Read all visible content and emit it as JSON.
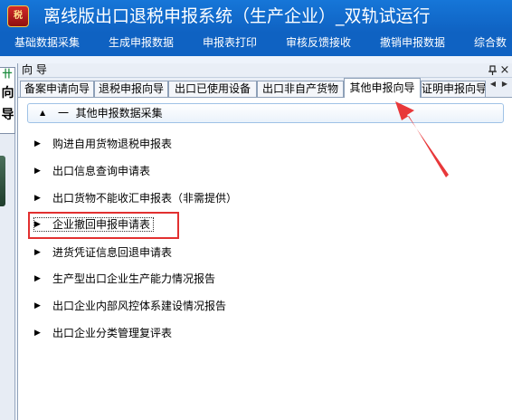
{
  "app": {
    "title": "离线版出口退税申报系统（生产企业）_双轨试运行",
    "icon": "tax-app-icon",
    "icon_text": "税"
  },
  "menu": [
    {
      "label": "基础数据采集"
    },
    {
      "label": "生成申报数据"
    },
    {
      "label": "申报表打印"
    },
    {
      "label": "审核反馈接收"
    },
    {
      "label": "撤销申报数据"
    },
    {
      "label": "综合数"
    }
  ],
  "left_strip": {
    "tab_label": "向导",
    "tab_glyph": "卄"
  },
  "panel": {
    "title": "向 导",
    "pin_icon": "pin-icon",
    "close_icon": "close-icon"
  },
  "tabs": [
    {
      "label": "备案申请向导",
      "active": false
    },
    {
      "label": "退税申报向导",
      "active": false
    },
    {
      "label": "出口已使用设备",
      "active": false
    },
    {
      "label": "出口非自产货物",
      "active": false
    },
    {
      "label": "其他申报向导",
      "active": true
    },
    {
      "label": "证明申报向导",
      "active": false
    }
  ],
  "section": {
    "collapse_glyph": "▲",
    "dash": "一",
    "title": "其他申报数据采集"
  },
  "items": [
    {
      "label": "购进自用货物退税申报表"
    },
    {
      "label": "出口信息查询申请表"
    },
    {
      "label": "出口货物不能收汇申报表（非需提供）"
    },
    {
      "label": "企业撤回申报申请表"
    },
    {
      "label": "进货凭证信息回退申请表"
    },
    {
      "label": "生产型出口企业生产能力情况报告"
    },
    {
      "label": "出口企业内部风控体系建设情况报告"
    },
    {
      "label": "出口企业分类管理复评表"
    }
  ],
  "annotation": {
    "highlighted_item_index": 3,
    "color": "#e23030"
  },
  "colors": {
    "titlebar": "#1676d8",
    "menubar": "#0f62c2",
    "highlight": "#e23030"
  }
}
